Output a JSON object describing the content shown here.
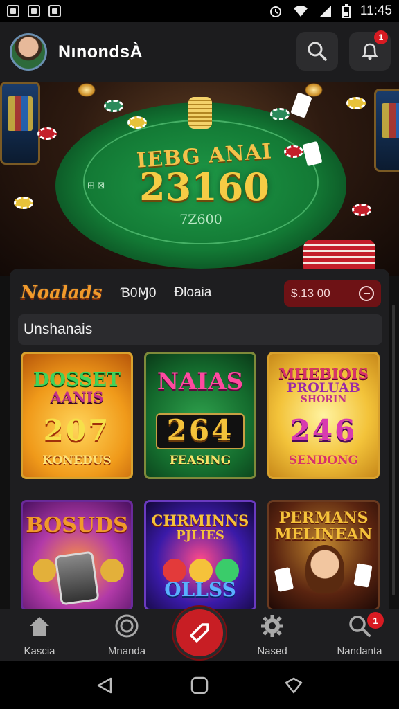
{
  "status_bar": {
    "time": "11:45"
  },
  "header": {
    "app_name": "NınondsÀ",
    "notification_count": "1"
  },
  "hero": {
    "table_title": "IEBG ANAI",
    "table_value": "23160",
    "table_subvalue": "7Z600",
    "table_mark": "⊞ ⊠"
  },
  "panel": {
    "logo": "Noalads",
    "tabs": [
      "Ɓ0Ɱ0",
      "Ɖloaia"
    ],
    "balance": "$.13 00",
    "section_title": "Unshanais"
  },
  "games": [
    {
      "title_line1": "DOSSET",
      "title_line2": "AANIS",
      "number": "207",
      "footer": "KONEDUS"
    },
    {
      "title_line1": "NAIAS",
      "number": "264",
      "footer": "FEASING"
    },
    {
      "title_line1": "MHEBIOIS",
      "title_line2": "PROLUAB",
      "title_line3": "SHORIN",
      "number": "246",
      "footer": "SENDONG"
    },
    {
      "title_line1": "BOSUDS"
    },
    {
      "title_line1": "CHRMINNS",
      "title_line2": "PJLIES",
      "footer": "OLLSS"
    },
    {
      "title_line1": "PERMANS",
      "title_line2": "MELINEAN"
    }
  ],
  "bottom_nav": {
    "items": [
      {
        "label": "Kascia",
        "icon": "home-icon"
      },
      {
        "label": "Mnanda",
        "icon": "coin-icon"
      },
      {
        "label": "",
        "icon": "center-action-icon"
      },
      {
        "label": "Nased",
        "icon": "gear-icon"
      },
      {
        "label": "Nandanta",
        "icon": "search-icon"
      }
    ],
    "badge_count": "1"
  },
  "colors": {
    "accent": "#c81e24",
    "gold": "#f5cc45",
    "panel": "#1e1e20"
  }
}
